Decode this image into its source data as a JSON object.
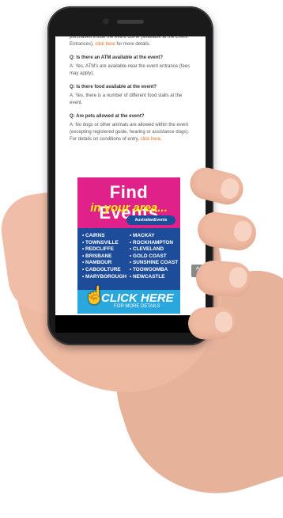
{
  "page": {
    "faq": [
      {
        "question": "",
        "answer_prefix": "purchased inside the event dome (available at the Event Entrances),",
        "link": "click here",
        "answer_suffix": " for more details."
      },
      {
        "question": "Q: Is there an ATM available at the event?",
        "answer_prefix": "A: Yes, ATM's are available near the event entrance (fees may apply).",
        "link": "",
        "answer_suffix": ""
      },
      {
        "question": "Q: Is there food available at the event?",
        "answer_prefix": "A: Yes, there is a number of different food stalls at the event.",
        "link": "",
        "answer_suffix": ""
      },
      {
        "question": "Q: Are pets allowed at the event?",
        "answer_prefix": "A:  No dogs or other animals are allowed within the event (excepting registered guide, hearing or assistance dogs). For details on conditions of entry,",
        "link": "click here",
        "answer_suffix": "."
      }
    ],
    "ad": {
      "title": "Find Events",
      "subtitle": "in your area...",
      "brand": "AustralianEvents",
      "cities_left": [
        "• CAIRNS",
        "• TOWNSVILLE",
        "• REDCLIFFE",
        "• BRISBANE",
        "• NAMBOUR",
        "• CABOOLTURE",
        "• MARYBOROUGH"
      ],
      "cities_right": [
        "• MACKAY",
        "• ROCKHAMPTON",
        "• CLEVELAND",
        "• GOLD COAST",
        "• SUNSHINE COAST",
        "• TOOWOOMBA",
        "• NEWCASTLE"
      ],
      "cta": "CLICK HERE",
      "cta_sub": "FOR MORE DETAILS"
    },
    "scroll_top_icon": "^"
  },
  "colors": {
    "link": "#e06a1e",
    "ad_pink": "#e0218a",
    "ad_blue": "#1d4d9a",
    "ad_yellow": "#fff200",
    "cta_blue": "#2aa7dc"
  }
}
